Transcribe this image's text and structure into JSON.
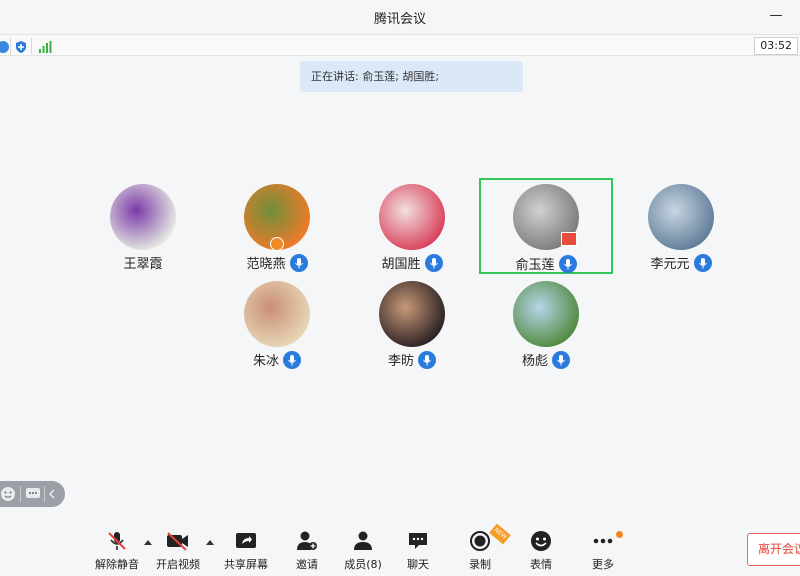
{
  "window": {
    "title": "腾讯会议"
  },
  "statusbar": {
    "timer": "03:52"
  },
  "speaking_banner": {
    "text": "正在讲话: 俞玉莲; 胡国胜;"
  },
  "participants": [
    {
      "name": "王翠霞",
      "mic": false,
      "color_a": "#e8ece4",
      "color_b": "#7b3aa8"
    },
    {
      "name": "范晓燕",
      "mic": true,
      "host": true,
      "color_a": "#f07a2a",
      "color_b": "#6f8f3a"
    },
    {
      "name": "胡国胜",
      "mic": true,
      "color_a": "#d9405a",
      "color_b": "#f0e0e0"
    },
    {
      "name": "俞玉莲",
      "mic": true,
      "active": true,
      "color_a": "#7c7c7c",
      "color_b": "#d0d0d0"
    },
    {
      "name": "李元元",
      "mic": true,
      "color_a": "#5f7d98",
      "color_b": "#c9d6e2"
    },
    {
      "name": "朱冰",
      "mic": true,
      "color_a": "#e8d7b8",
      "color_b": "#c98f74"
    },
    {
      "name": "李昉",
      "mic": true,
      "color_a": "#2a2023",
      "color_b": "#c89a78"
    },
    {
      "name": "杨彪",
      "mic": true,
      "color_a": "#4f8a3e",
      "color_b": "#b7d5ea"
    }
  ],
  "toolbar": {
    "unmute": "解除静音",
    "start_video": "开启视频",
    "share_screen": "共享屏幕",
    "invite": "邀请",
    "members": "成员(8)",
    "chat": "聊天",
    "record": "录制",
    "reactions": "表情",
    "more": "更多",
    "leave": "离开会议",
    "record_badge": "NEW"
  },
  "colors": {
    "accent": "#2b7bdf",
    "active_border": "#34c759",
    "leave": "#e0443a"
  }
}
